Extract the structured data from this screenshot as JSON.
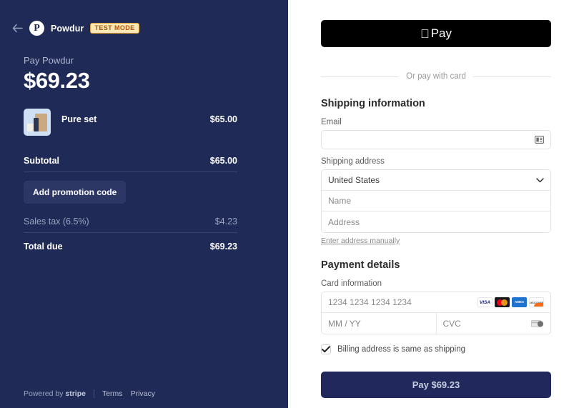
{
  "colors": {
    "panel_navy": "#1f2a57",
    "promo_button": "#2c3766",
    "pay_button": "#21295c",
    "apple_pay_bg": "#000000",
    "test_badge_text": "#b45309",
    "test_badge_bg": "#fde9b8"
  },
  "left_panel": {
    "back_icon": "back-arrow-icon",
    "logo_letter": "P",
    "brand_name": "Powdur",
    "test_mode_badge": "TEST MODE",
    "pay_title": "Pay Powdur",
    "pay_amount": "$69.23",
    "items": [
      {
        "name": "Pure set",
        "price": "$65.00"
      }
    ],
    "subtotal_label": "Subtotal",
    "subtotal_value": "$65.00",
    "promo_button_label": "Add promotion code",
    "tax_label": "Sales tax (6.5%)",
    "tax_value": "$4.23",
    "total_label": "Total due",
    "total_value": "$69.23",
    "footer": {
      "powered_by": "Powered by",
      "stripe": "stripe",
      "terms": "Terms",
      "privacy": "Privacy"
    }
  },
  "right_panel": {
    "apple_pay_label": "Pay",
    "divider_text": "Or pay with card",
    "shipping_section_title": "Shipping information",
    "email_label": "Email",
    "email_value": "",
    "email_placeholder": "",
    "shipping_address_label": "Shipping address",
    "country_value": "United States",
    "name_placeholder": "Name",
    "address_placeholder": "Address",
    "manual_address_link": "Enter address manually",
    "payment_section_title": "Payment details",
    "card_information_label": "Card information",
    "card_number_placeholder": "1234 1234 1234 1234",
    "expiry_placeholder": "MM / YY",
    "cvc_placeholder": "CVC",
    "card_brands": [
      "VISA",
      "Mastercard",
      "Amex",
      "Discover"
    ],
    "billing_checkbox_label": "Billing address is same as shipping",
    "billing_checkbox_checked": true,
    "pay_button_label": "Pay $69.23"
  }
}
